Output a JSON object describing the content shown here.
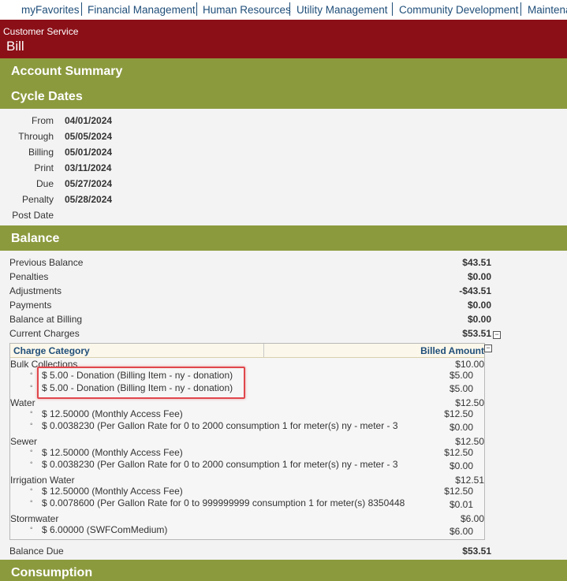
{
  "nav": {
    "items": [
      "myFavorites",
      "Financial Management",
      "Human Resources",
      "Utility Management",
      "Community Development",
      "Maintena"
    ]
  },
  "banner": {
    "module": "Customer Service",
    "title": "Bill"
  },
  "sections": {
    "account_summary": "Account Summary",
    "cycle_dates": "Cycle Dates",
    "balance": "Balance",
    "consumption": "Consumption"
  },
  "cycle_dates": [
    {
      "label": "From",
      "value": "04/01/2024"
    },
    {
      "label": "Through",
      "value": "05/05/2024"
    },
    {
      "label": "Billing",
      "value": "05/01/2024"
    },
    {
      "label": "Print",
      "value": "03/11/2024"
    },
    {
      "label": "Due",
      "value": "05/27/2024"
    },
    {
      "label": "Penalty",
      "value": "05/28/2024"
    },
    {
      "label": "Post Date",
      "value": ""
    }
  ],
  "balance": {
    "rows": [
      {
        "label": "Previous Balance",
        "value": "$43.51"
      },
      {
        "label": "Penalties",
        "value": "$0.00"
      },
      {
        "label": "Adjustments",
        "value": "-$43.51"
      },
      {
        "label": "Payments",
        "value": "$0.00"
      },
      {
        "label": "Balance at Billing",
        "value": "$0.00"
      },
      {
        "label": "Current Charges",
        "value": "$53.51"
      }
    ],
    "balance_due_label": "Balance Due",
    "balance_due_value": "$53.51",
    "collapse_glyph": "−"
  },
  "charges": {
    "header_category": "Charge Category",
    "header_amount": "Billed Amount",
    "categories": [
      {
        "name": "Bulk Collections",
        "amount": "$10.00",
        "items": [
          {
            "text": "$ 5.00 - Donation (Billing Item - ny - donation)",
            "amount": "$5.00"
          },
          {
            "text": "$ 5.00 - Donation (Billing Item - ny - donation)",
            "amount": "$5.00"
          }
        ]
      },
      {
        "name": "Water",
        "amount": "$12.50",
        "items": [
          {
            "text": "$ 12.50000 (Monthly Access Fee)",
            "amount": "$12.50"
          },
          {
            "text": "$ 0.0038230 (Per Gallon Rate for 0 to 2000 consumption 1 for meter(s) ny - meter - 3",
            "amount": "$0.00"
          }
        ]
      },
      {
        "name": "Sewer",
        "amount": "$12.50",
        "items": [
          {
            "text": "$ 12.50000 (Monthly Access Fee)",
            "amount": "$12.50"
          },
          {
            "text": "$ 0.0038230 (Per Gallon Rate for 0 to 2000 consumption 1 for meter(s) ny - meter - 3",
            "amount": "$0.00"
          }
        ]
      },
      {
        "name": "Irrigation Water",
        "amount": "$12.51",
        "items": [
          {
            "text": "$ 12.50000 (Monthly Access Fee)",
            "amount": "$12.50"
          },
          {
            "text": "$ 0.0078600 (Per Gallon Rate for 0 to 999999999 consumption 1 for meter(s) 8350448",
            "amount": "$0.01"
          }
        ]
      },
      {
        "name": "Stormwater",
        "amount": "$6.00",
        "items": [
          {
            "text": "$ 6.00000 (SWFComMedium)",
            "amount": "$6.00"
          }
        ]
      }
    ]
  },
  "colors": {
    "banner": "#8b0f17",
    "section": "#8c9a3e",
    "nav_link": "#1f4e79",
    "highlight": "#e0474c"
  }
}
